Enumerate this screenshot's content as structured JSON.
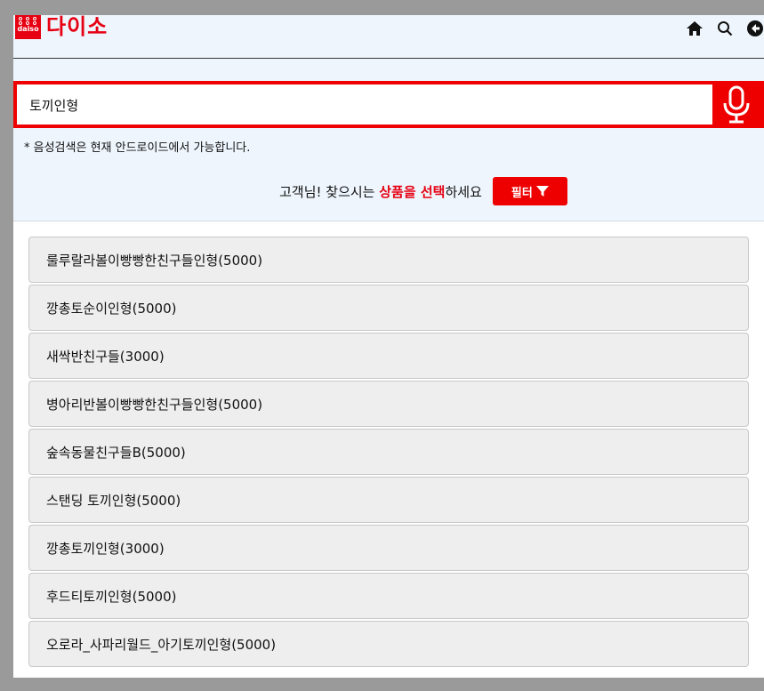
{
  "header": {
    "logo_mark_text": "daiso",
    "logo_text": "다이소",
    "icons": [
      "home-icon",
      "search-icon",
      "back-icon"
    ]
  },
  "search": {
    "value": "토끼인형",
    "placeholder": "",
    "mic_icon": "microphone-icon",
    "notice": "* 음성검색은 현재 안드로이드에서 가능합니다."
  },
  "prompt": {
    "before": "고객님! 찾으시는 ",
    "highlight": "상품을 선택",
    "after": "하세요",
    "filter_label": "필터",
    "filter_icon": "filter-icon"
  },
  "results": [
    "룰루랄라볼이빵빵한친구들인형(5000)",
    "깡총토순이인형(5000)",
    "새싹반친구들(3000)",
    "병아리반볼이빵빵한친구들인형(5000)",
    "숲속동물친구들B(5000)",
    "스탠딩 토끼인형(5000)",
    "깡총토끼인형(3000)",
    "후드티토끼인형(5000)",
    "오로라_사파리월드_아기토끼인형(5000)"
  ],
  "colors": {
    "brand_red": "#e60012",
    "accent_red": "#ee0000",
    "header_bg": "#eef5fc",
    "item_bg": "#eeeeee"
  }
}
